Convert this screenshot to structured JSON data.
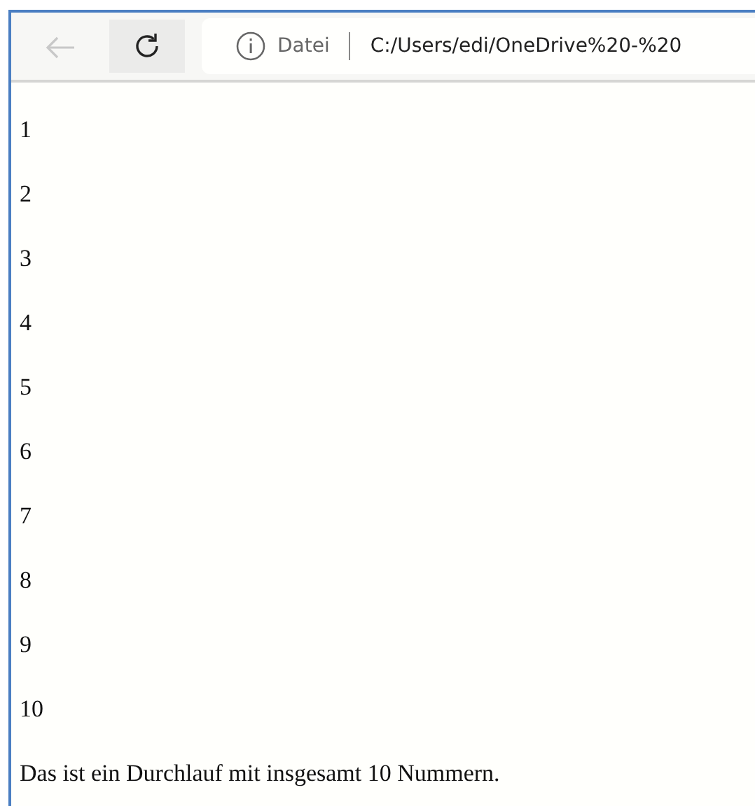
{
  "toolbar": {
    "back_button": {
      "disabled": true
    },
    "address_bar": {
      "scheme_label": "Datei",
      "url": "C:/Users/edi/OneDrive%20-%20"
    }
  },
  "page": {
    "lines": [
      "1",
      "2",
      "3",
      "4",
      "5",
      "6",
      "7",
      "8",
      "9",
      "10"
    ],
    "summary": "Das ist ein Durchlauf mit insgesamt 10 Nummern."
  }
}
